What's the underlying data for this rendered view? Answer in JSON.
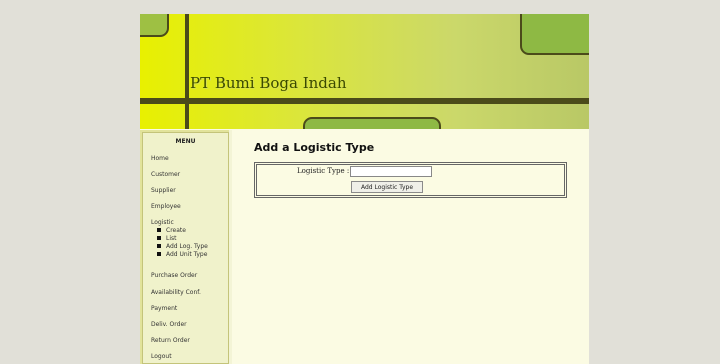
{
  "header": {
    "company_name": "PT Bumi Boga Indah"
  },
  "menu": {
    "title": "MENU",
    "items": [
      {
        "label": "Home"
      },
      {
        "label": "Customer"
      },
      {
        "label": "Supplier"
      },
      {
        "label": "Employee"
      },
      {
        "label": "Logistic",
        "children": [
          "Create",
          "List",
          "Add Log. Type",
          "Add Unit Type"
        ]
      },
      {
        "label": "Purchase Order"
      },
      {
        "label": "Availability Conf."
      },
      {
        "label": "Payment"
      },
      {
        "label": "Deliv. Order"
      },
      {
        "label": "Return Order"
      },
      {
        "label": "Logout"
      }
    ]
  },
  "main": {
    "title": "Add a Logistic Type",
    "form": {
      "field_label": "Logistic Type :",
      "field_value": "",
      "submit_label": "Add Logistic Type"
    }
  }
}
